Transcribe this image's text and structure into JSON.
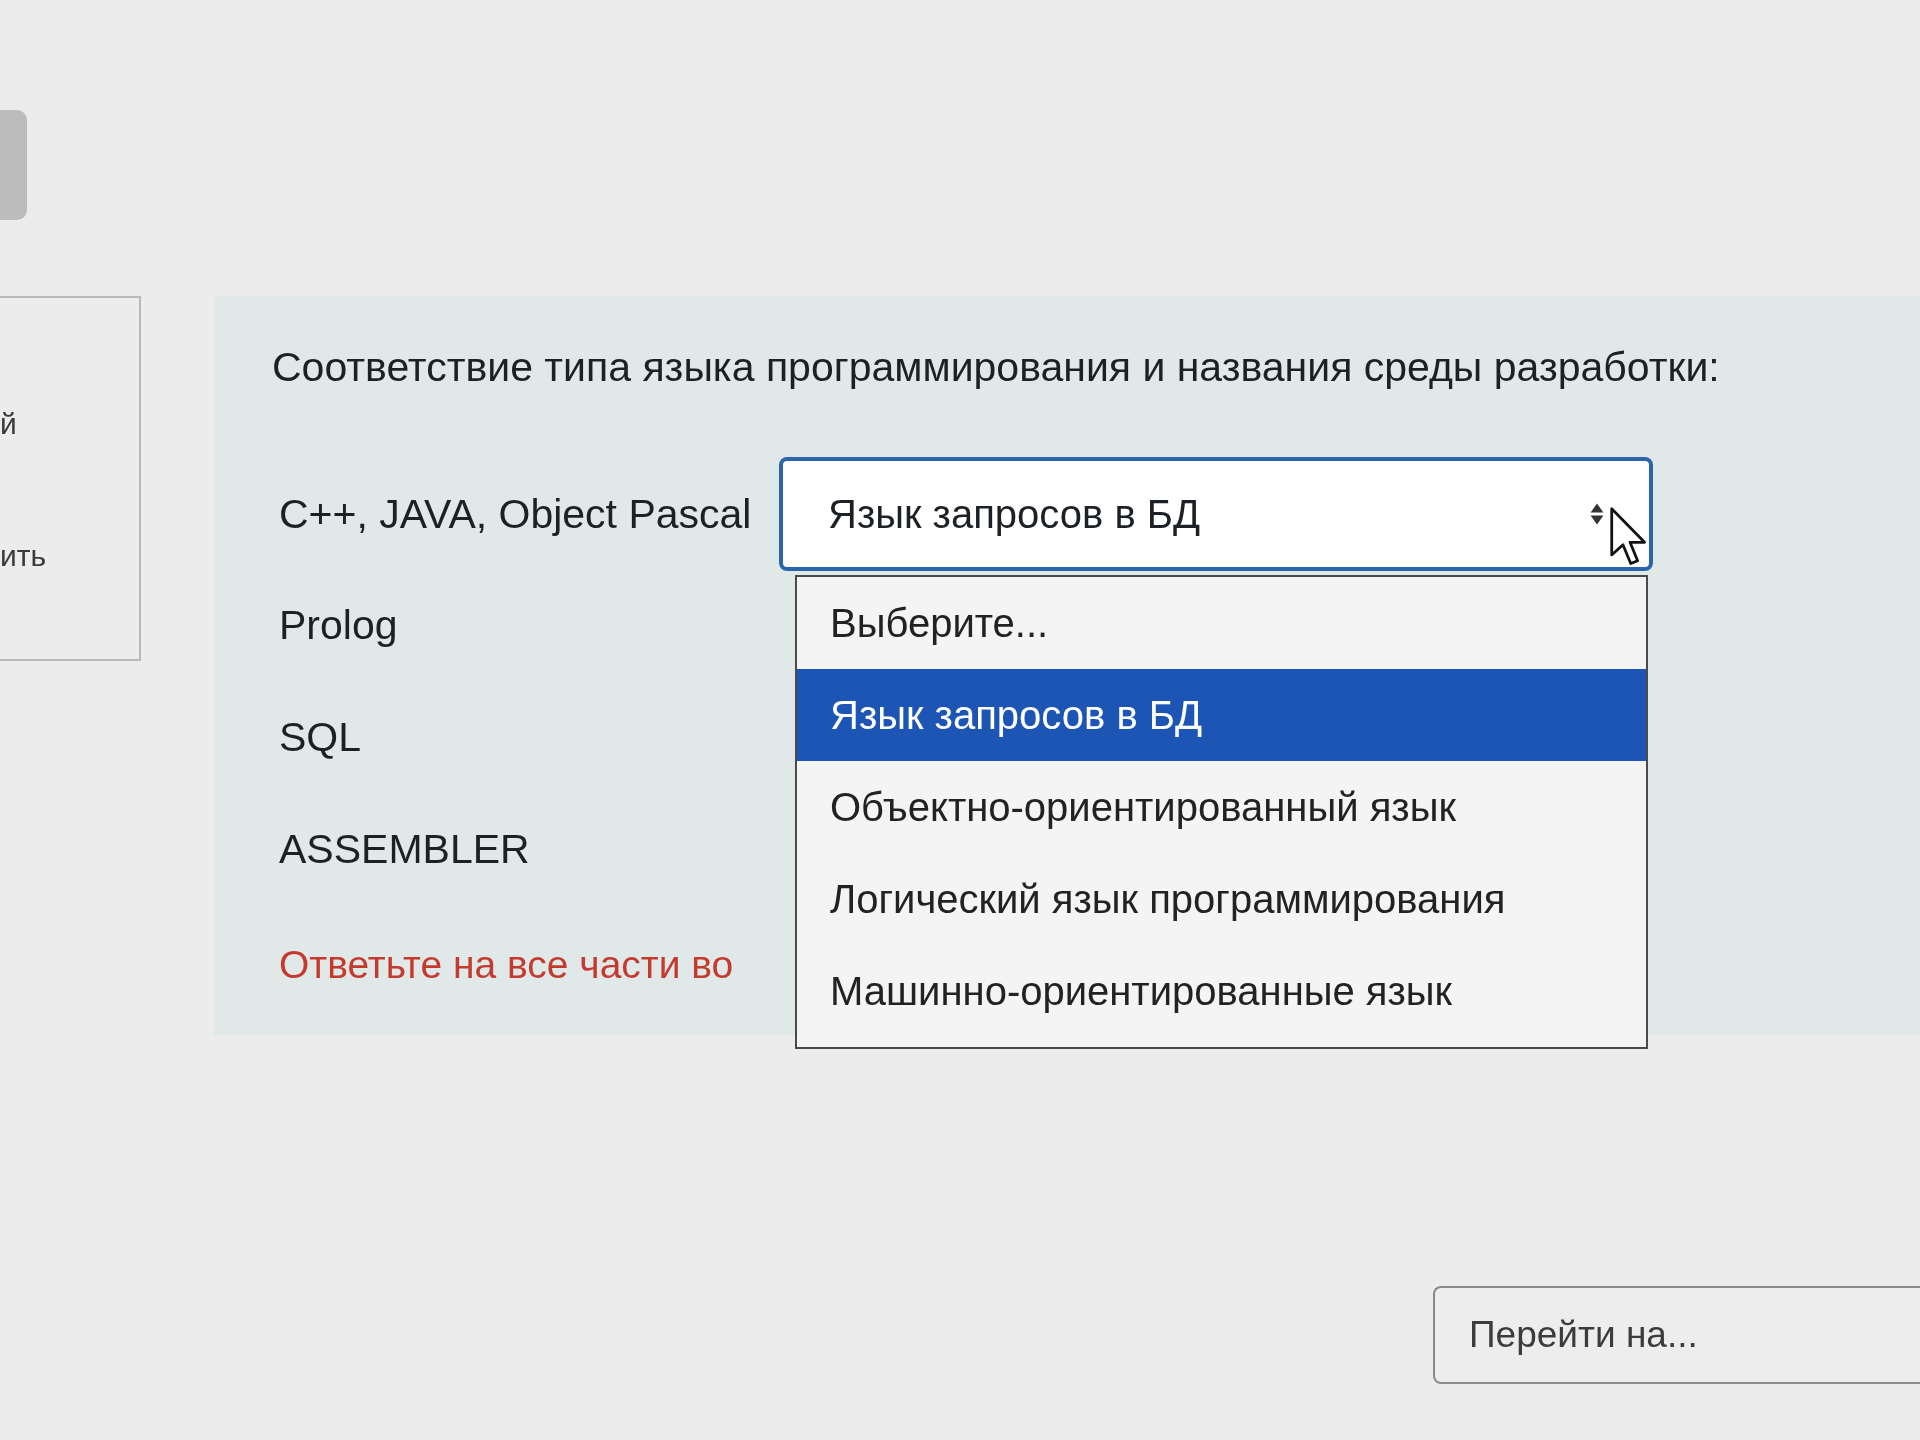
{
  "info_panel": {
    "lines": [
      "й",
      "ить"
    ]
  },
  "question": {
    "prompt": "Соответствие типа языка программирования и названия среды разработки:",
    "rows": [
      {
        "label": "C++, JAVA, Object Pascal",
        "value": "Язык запросов в БД",
        "expanded": true,
        "options": [
          {
            "label": "Выберите...",
            "selected": false
          },
          {
            "label": "Язык запросов в БД",
            "selected": true
          },
          {
            "label": "Объектно-ориентированный язык",
            "selected": false
          },
          {
            "label": "Логический язык программирования",
            "selected": false
          },
          {
            "label": "Машинно-ориентированные язык",
            "selected": false
          }
        ]
      },
      {
        "label": "Prolog"
      },
      {
        "label": "SQL"
      },
      {
        "label": "ASSEMBLER"
      }
    ],
    "validation_error": "Ответьте на все части во"
  },
  "jump_select": {
    "value": "Перейти на..."
  }
}
